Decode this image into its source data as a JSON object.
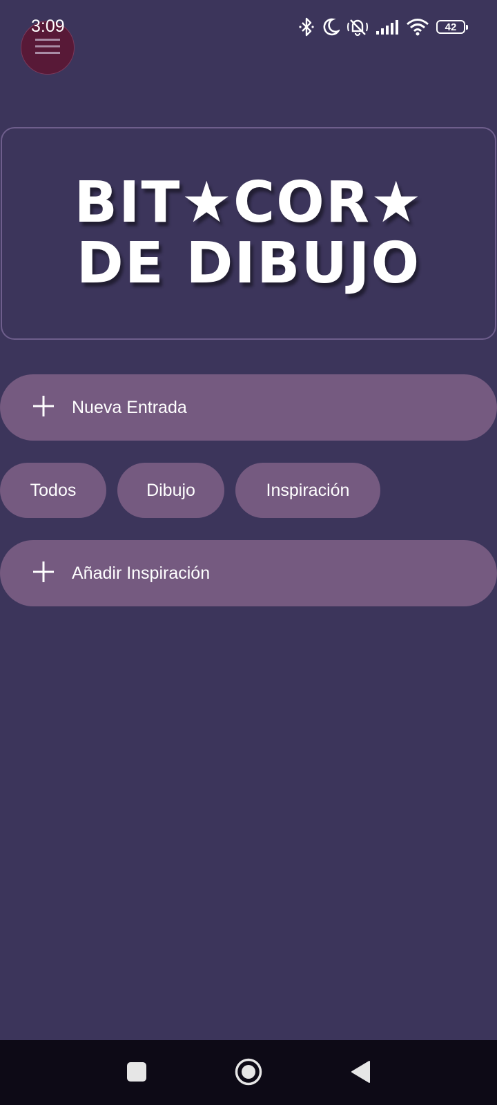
{
  "status_bar": {
    "time": "3:09",
    "battery": "42",
    "icons": [
      "bluetooth-icon",
      "moon-icon",
      "notifications-off-icon",
      "signal-icon",
      "wifi-icon",
      "battery-icon"
    ]
  },
  "menu_button": {
    "icon": "hamburger-menu-icon"
  },
  "title": "BIT★COR★ DE DIBUJO",
  "actions": {
    "new_entry_label": "Nueva Entrada",
    "add_inspiration_label": "Añadir Inspiración"
  },
  "filters": [
    {
      "label": "Todos"
    },
    {
      "label": "Dibujo"
    },
    {
      "label": "Inspiración"
    }
  ],
  "colors": {
    "background": "#3c355b",
    "button": "#755a80",
    "menu_fab": "#581937",
    "card_border": "#6e5e8c",
    "nav_bar": "#0d0a16"
  }
}
